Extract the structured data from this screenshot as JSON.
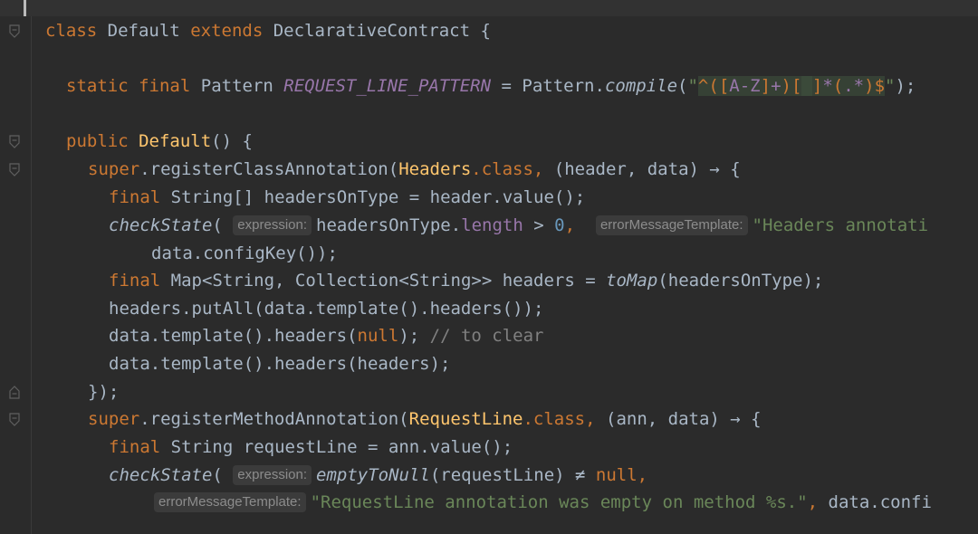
{
  "tokens": {
    "class_kw": "class",
    "class_name": "Default",
    "extends_kw": "extends",
    "super_class": "DeclarativeContract",
    "open_brace": "{",
    "static_kw": "static",
    "final_kw": "final",
    "pattern_type": "Pattern",
    "const_name": "REQUEST_LINE_PATTERN",
    "eq": "=",
    "pattern_call": "Pattern.",
    "compile_method": "compile",
    "quote": "\"",
    "rx_caret": "^",
    "rx_paren_open": "(",
    "rx_bracket_open": "[",
    "rx_range": "A-Z",
    "rx_bracket_close": "]",
    "rx_plus": "+",
    "rx_paren_close": ")",
    "rx_space_class_open": "[",
    "rx_space": " ",
    "rx_space_class_close": "]",
    "rx_star": "*",
    "rx_dotstar": ".*",
    "rx_dollar": "$",
    "public_kw": "public",
    "ctor_name": "Default",
    "super_kw": "super",
    "register_class": ".registerClassAnnotation(",
    "headers_cls": "Headers",
    "dot_class": ".class,",
    "lambda1_params": "(header, data) → {",
    "string_arr_type": "String[]",
    "headers_on_type_decl": "headersOnType = header.value();",
    "check_state": "checkState",
    "paren": "(",
    "headers_on_type_ref": "headersOnType.",
    "length_field": "length",
    "gt": ">",
    "zero": "0",
    "comma": ",",
    "headers_annot_str": "\"Headers annotati",
    "config_key_line": "data.configKey());",
    "map_type": "Map<String, Collection<String>> headers =",
    "to_map": "toMap",
    "to_map_args": "(headersOnType);",
    "put_all_line": "headers.putAll(data.template().headers());",
    "headers_null_pre": "data.template().headers(",
    "null_kw": "null",
    "headers_null_post": ");",
    "comment_clear": "// to clear",
    "headers_set_line": "data.template().headers(headers);",
    "close_lambda": "});",
    "register_method": ".registerMethodAnnotation(",
    "request_line_cls": "RequestLine",
    "lambda2_params": "(ann, data) → {",
    "string_type": "String",
    "request_line_decl": "requestLine = ann.value();",
    "empty_to_null": "emptyToNull",
    "empty_args": "(requestLine) ≠",
    "null_comma": "null,",
    "request_line_str": "\"RequestLine annotation was empty on method %s.\"",
    "data_confi": ", data.confi"
  },
  "hints": {
    "expression": "expression:",
    "error_template": "errorMessageTemplate:"
  }
}
